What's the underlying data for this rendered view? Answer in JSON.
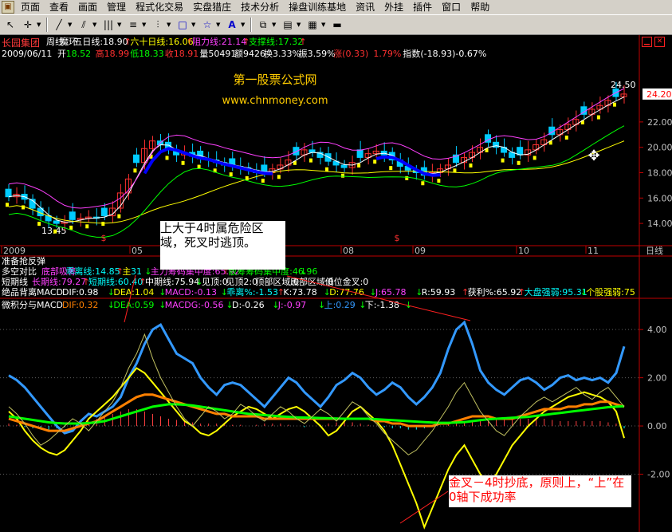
{
  "menu": [
    "页面",
    "查看",
    "画面",
    "管理",
    "程式化交易",
    "实盘猎庄",
    "技术分析",
    "操盘训练基地",
    "资讯",
    "外挂",
    "插件",
    "窗口",
    "帮助"
  ],
  "toolbar_icons": [
    "pointer",
    "cross",
    "line",
    "ray",
    "table",
    "chart",
    "pattern",
    "rect",
    "star",
    "text",
    "copy",
    "box",
    "palette",
    "save"
  ],
  "stock_name": "长园集团",
  "header1": [
    {
      "t": "周线",
      "c": "#ffffff"
    },
    {
      "t": "魔环",
      "c": "#ffffff"
    },
    {
      "t": "五日线:18.90",
      "c": "#ffffff"
    },
    {
      "t": "↑",
      "c": "#ff3030"
    },
    {
      "t": "六十日线:16.06",
      "c": "#ffff00"
    },
    {
      "t": "↑",
      "c": "#ff3030"
    },
    {
      "t": "阻力线:21.14",
      "c": "#ff40ff"
    },
    {
      "t": "↑",
      "c": "#ff3030"
    },
    {
      "t": "支撑线:17.32",
      "c": "#00ff00"
    },
    {
      "t": "↑",
      "c": "#ff3030"
    }
  ],
  "header2": [
    {
      "t": "2009/06/11",
      "c": "#ffffff"
    },
    {
      "t": "开",
      "c": "#ffffff"
    },
    {
      "t": "18.52",
      "c": "#00ff00"
    },
    {
      "t": "高18.99",
      "c": "#ff3030"
    },
    {
      "t": "低18.33",
      "c": "#00ff00"
    },
    {
      "t": "收18.91",
      "c": "#ff3030"
    },
    {
      "t": "量50491",
      "c": "#ffffff"
    },
    {
      "t": "额9426",
      "c": "#ffffff"
    },
    {
      "t": "换3.33%",
      "c": "#ffffff"
    },
    {
      "t": "振3.59%",
      "c": "#ffffff"
    },
    {
      "t": "涨(0.33)",
      "c": "#ff3030"
    },
    {
      "t": "1.79%",
      "c": "#ff3030"
    },
    {
      "t": "指数(-18.93)-0.67%",
      "c": "#ffffff"
    }
  ],
  "watermark": {
    "title": "第一股票公式网",
    "url": "www.chnmoney.com",
    "color": "#ffcc00"
  },
  "annotation_top": "上大于4时属危险区域，死叉时逃顶。",
  "annotation_bottom": "金叉－4时抄底，原则上，“上”在0轴下成功率",
  "last_price": "24.20",
  "peak_label": "24.50",
  "low_label": "13.45",
  "sell_marker": "$",
  "period_label": "日线",
  "month_labels": [
    "2009",
    "05",
    "06",
    "07",
    "08",
    "09",
    "10",
    "11"
  ],
  "row_names": [
    "准备抢反弹",
    "多空对比",
    "短期线",
    "绝品背离MACD",
    "微积分与MACD"
  ],
  "row_duokong": [
    {
      "t": "底部吸筹",
      "c": "#ff40ff"
    },
    {
      "t": "乖离线:14.85",
      "c": "#00ffff"
    },
    {
      "t": "↑",
      "c": "#ff3030"
    },
    {
      "t": "主",
      "c": "#ffff00"
    },
    {
      "t": "31",
      "c": "#00ffff"
    },
    {
      "t": "↓",
      "c": "#00ff00"
    },
    {
      "t": "主力筹码集中度:65.92",
      "c": "#ff40ff"
    },
    {
      "t": "↑",
      "c": "#ff3030"
    },
    {
      "t": "散筹筹码集中度:46.96",
      "c": "#00ff00"
    },
    {
      "t": "↓",
      "c": "#00ff00"
    }
  ],
  "row_duanqi": [
    {
      "t": "长期线:79.27",
      "c": "#ff40ff"
    },
    {
      "t": "↑",
      "c": "#ff3030"
    },
    {
      "t": "短期线:60.40",
      "c": "#00ffff"
    },
    {
      "t": "↑",
      "c": "#ff3030"
    },
    {
      "t": "中期线:75.94",
      "c": "#ffffff"
    },
    {
      "t": "↓",
      "c": "#00ff00"
    },
    {
      "t": "见顶:0",
      "c": "#ffffff"
    },
    {
      "t": "见顶2:0",
      "c": "#ffffff"
    },
    {
      "t": "顶部区域:0",
      "c": "#ffffff"
    },
    {
      "t": "底部区域:0",
      "c": "#ffffff"
    },
    {
      "t": "低位金叉:0",
      "c": "#ffffff"
    }
  ],
  "row_jueping": [
    {
      "t": "DIF:0.98",
      "c": "#ffffff"
    },
    {
      "t": "↓",
      "c": "#00ff00"
    },
    {
      "t": "DEA:1.04",
      "c": "#ffff00"
    },
    {
      "t": "↓",
      "c": "#00ff00"
    },
    {
      "t": "MACD:-0.13",
      "c": "#ff40ff"
    },
    {
      "t": "↓",
      "c": "#00ff00"
    },
    {
      "t": "乖离%:-1.53",
      "c": "#00ffff"
    },
    {
      "t": "↑",
      "c": "#ff3030"
    },
    {
      "t": "K:73.78",
      "c": "#ffffff"
    },
    {
      "t": "↓",
      "c": "#00ff00"
    },
    {
      "t": "D:77.76",
      "c": "#ffff00"
    },
    {
      "t": "↓",
      "c": "#00ff00"
    },
    {
      "t": "J:65.78",
      "c": "#ff40ff"
    },
    {
      "t": "↓",
      "c": "#00ff00"
    },
    {
      "t": "R:59.93",
      "c": "#ffffff"
    },
    {
      "t": "↑",
      "c": "#ff3030"
    },
    {
      "t": "获利%:65.92",
      "c": "#ffffff"
    },
    {
      "t": "↑",
      "c": "#ff3030"
    },
    {
      "t": "大盘强弱:95.31",
      "c": "#00ffff"
    },
    {
      "t": "↓",
      "c": "#00ff00"
    },
    {
      "t": "个股强弱:75",
      "c": "#ffff00"
    }
  ],
  "row_weiji": [
    {
      "t": "DIF:0.32",
      "c": "#ff8000"
    },
    {
      "t": "↓",
      "c": "#00ff00"
    },
    {
      "t": "DEA:0.59",
      "c": "#00ff00"
    },
    {
      "t": "↓",
      "c": "#00ff00"
    },
    {
      "t": "MACDG:-0.56",
      "c": "#ff40ff"
    },
    {
      "t": "↓",
      "c": "#00ff00"
    },
    {
      "t": "D:-0.26",
      "c": "#ffffff"
    },
    {
      "t": "↓",
      "c": "#00ff00"
    },
    {
      "t": "J:-0.97",
      "c": "#ff40ff"
    },
    {
      "t": "↓",
      "c": "#00ff00"
    },
    {
      "t": "上:0.29",
      "c": "#3399ff"
    },
    {
      "t": "↓",
      "c": "#00ff00"
    },
    {
      "t": "下:-1.38",
      "c": "#ffffff"
    },
    {
      "t": "↓",
      "c": "#00ff00"
    }
  ],
  "chart_data": [
    {
      "type": "candlestick",
      "price_axis": [
        14.0,
        16.0,
        18.0,
        20.0,
        22.0
      ],
      "ylim": [
        13.0,
        25.2
      ],
      "x_labels": [
        "2009",
        "05",
        "06",
        "07",
        "08",
        "09",
        "10",
        "11"
      ],
      "close_series": [
        16.1,
        16.3,
        15.9,
        15.2,
        14.6,
        14.2,
        14.0,
        14.1,
        14.3,
        14.4,
        14.5,
        14.4,
        14.6,
        15.2,
        16.4,
        17.5,
        18.8,
        19.9,
        20.5,
        20.2,
        19.8,
        19.4,
        19.6,
        19.3,
        19.1,
        19.0,
        18.8,
        18.6,
        18.5,
        18.4,
        18.2,
        18.0,
        18.0,
        18.3,
        18.6,
        19.0,
        19.4,
        19.8,
        19.6,
        19.2,
        18.9,
        18.6,
        18.4,
        18.8,
        19.2,
        19.5,
        19.7,
        19.4,
        19.0,
        18.5,
        18.2,
        18.0,
        17.8,
        18.0,
        18.3,
        18.6,
        18.8,
        19.2,
        19.6,
        20.0,
        20.4,
        20.0,
        19.6,
        19.2,
        19.4,
        19.8,
        20.2,
        20.6,
        21.0,
        21.4,
        21.8,
        22.2,
        22.6,
        23.0,
        23.3,
        23.7,
        24.0,
        24.2
      ],
      "ma_series": [
        {
          "name": "五日线",
          "color": "#ffffff"
        },
        {
          "name": "六十日线",
          "color": "#ffff00"
        },
        {
          "name": "阻力线",
          "color": "#ff40ff"
        },
        {
          "name": "支撑线",
          "color": "#00ff00"
        }
      ],
      "peak_value": 24.5,
      "low_value": 13.45,
      "last_value": 24.2
    },
    {
      "type": "line",
      "y_axis": [
        4.0,
        2.0,
        0.0,
        -2.0
      ],
      "ylim": [
        -4.3,
        4.8
      ],
      "series": [
        {
          "name": "上",
          "color": "#3399ff",
          "values": [
            2.1,
            1.9,
            1.6,
            1.2,
            0.8,
            0.4,
            0.0,
            -0.3,
            -0.2,
            0.2,
            0.5,
            0.4,
            0.6,
            0.8,
            1.2,
            2.0,
            2.6,
            3.4,
            4.0,
            4.2,
            3.6,
            3.0,
            2.8,
            2.6,
            2.0,
            1.6,
            1.3,
            1.7,
            1.8,
            1.7,
            1.4,
            1.1,
            0.8,
            1.2,
            1.6,
            2.0,
            1.8,
            1.4,
            1.1,
            0.8,
            1.2,
            1.7,
            1.9,
            2.2,
            2.0,
            1.6,
            1.3,
            1.5,
            1.8,
            1.6,
            1.2,
            0.9,
            1.2,
            1.6,
            2.2,
            3.2,
            4.0,
            4.3,
            3.4,
            2.3,
            1.8,
            1.5,
            1.3,
            1.6,
            1.9,
            2.0,
            1.8,
            1.5,
            1.7,
            2.0,
            2.1,
            1.9,
            2.0,
            1.9,
            2.0,
            1.8,
            2.2,
            3.3
          ]
        },
        {
          "name": "下",
          "color": "#ffff00",
          "values": [
            0.6,
            0.3,
            -0.2,
            -0.6,
            -0.9,
            -1.1,
            -1.2,
            -1.0,
            -0.6,
            -0.2,
            0.3,
            0.6,
            0.9,
            1.2,
            1.6,
            2.0,
            2.4,
            2.2,
            1.8,
            1.4,
            1.0,
            0.6,
            0.2,
            0.0,
            -0.3,
            -0.4,
            -0.2,
            0.1,
            0.4,
            0.6,
            0.8,
            0.7,
            0.5,
            0.3,
            0.5,
            0.7,
            0.8,
            0.6,
            0.3,
            0.0,
            -0.4,
            -0.2,
            0.2,
            0.6,
            0.8,
            0.5,
            0.2,
            -0.2,
            -0.8,
            -1.6,
            -2.4,
            -3.2,
            -4.2,
            -3.4,
            -2.6,
            -1.8,
            -1.2,
            -0.8,
            -1.4,
            -2.0,
            -2.4,
            -2.0,
            -1.4,
            -0.8,
            -0.4,
            0.0,
            0.3,
            0.6,
            0.8,
            1.0,
            1.2,
            1.3,
            1.4,
            1.3,
            1.2,
            1.0,
            0.6,
            -0.5
          ]
        },
        {
          "name": "DIF",
          "color": "#ff8000",
          "values": [
            0.3,
            0.2,
            0.1,
            0.0,
            -0.1,
            -0.2,
            -0.2,
            -0.2,
            -0.1,
            0.0,
            0.1,
            0.2,
            0.4,
            0.6,
            0.8,
            1.0,
            1.2,
            1.3,
            1.3,
            1.2,
            1.1,
            1.0,
            0.9,
            0.8,
            0.7,
            0.6,
            0.5,
            0.5,
            0.4,
            0.4,
            0.4,
            0.4,
            0.3,
            0.3,
            0.3,
            0.3,
            0.3,
            0.3,
            0.3,
            0.3,
            0.3,
            0.3,
            0.3,
            0.3,
            0.3,
            0.3,
            0.2,
            0.2,
            0.1,
            0.1,
            0.0,
            0.0,
            0.0,
            0.0,
            0.1,
            0.1,
            0.2,
            0.3,
            0.4,
            0.4,
            0.4,
            0.3,
            0.3,
            0.3,
            0.4,
            0.5,
            0.6,
            0.7,
            0.7,
            0.7,
            0.8,
            0.8,
            0.9,
            0.9,
            1.0,
            1.0,
            0.9,
            0.8
          ]
        },
        {
          "name": "DEA",
          "color": "#00ff00",
          "values": [
            0.4,
            0.35,
            0.3,
            0.25,
            0.2,
            0.15,
            0.12,
            0.1,
            0.1,
            0.1,
            0.12,
            0.15,
            0.2,
            0.3,
            0.4,
            0.5,
            0.6,
            0.7,
            0.8,
            0.85,
            0.9,
            0.9,
            0.88,
            0.85,
            0.8,
            0.75,
            0.7,
            0.65,
            0.6,
            0.55,
            0.5,
            0.48,
            0.45,
            0.43,
            0.4,
            0.38,
            0.36,
            0.35,
            0.34,
            0.33,
            0.32,
            0.31,
            0.3,
            0.3,
            0.3,
            0.3,
            0.28,
            0.26,
            0.24,
            0.22,
            0.2,
            0.18,
            0.16,
            0.14,
            0.13,
            0.13,
            0.14,
            0.16,
            0.2,
            0.24,
            0.28,
            0.3,
            0.32,
            0.34,
            0.36,
            0.38,
            0.42,
            0.46,
            0.5,
            0.54,
            0.58,
            0.62,
            0.66,
            0.7,
            0.74,
            0.78,
            0.8,
            0.82
          ]
        },
        {
          "name": "D",
          "color": "#c0c060",
          "values": [
            0.8,
            0.5,
            0.1,
            -0.4,
            -0.8,
            -0.6,
            -0.3,
            0.0,
            0.3,
            0.1,
            -0.2,
            0.2,
            0.6,
            1.0,
            1.6,
            2.4,
            3.0,
            3.8,
            2.8,
            2.0,
            1.4,
            0.8,
            0.3,
            0.0,
            0.4,
            0.8,
            0.6,
            0.3,
            0.5,
            0.9,
            0.7,
            0.4,
            0.2,
            0.5,
            0.8,
            0.6,
            0.3,
            0.1,
            0.4,
            0.7,
            0.5,
            0.2,
            0.6,
            1.0,
            0.8,
            0.4,
            0.1,
            -0.3,
            -0.6,
            -0.9,
            -1.2,
            -1.0,
            -0.6,
            -0.2,
            0.3,
            0.8,
            1.4,
            1.8,
            1.2,
            0.6,
            0.2,
            -0.2,
            -0.4,
            0.0,
            0.4,
            0.7,
            1.0,
            1.2,
            1.0,
            1.2,
            1.4,
            1.6,
            1.3,
            1.1,
            1.4,
            1.6,
            1.2,
            0.8
          ]
        }
      ],
      "bars": {
        "name": "MACDG",
        "color_pos": "#ff4040",
        "color_neg": "#00ffff",
        "values": [
          0.1,
          0.05,
          -0.05,
          -0.1,
          -0.15,
          -0.15,
          -0.1,
          -0.05,
          0.0,
          0.1,
          0.2,
          0.3,
          0.4,
          0.5,
          0.6,
          0.7,
          0.7,
          0.6,
          0.5,
          0.4,
          0.3,
          0.25,
          0.2,
          0.15,
          0.1,
          0.1,
          0.1,
          0.1,
          0.05,
          0.05,
          0.0,
          0.05,
          0.1,
          0.1,
          0.1,
          0.05,
          0.0,
          -0.05,
          0.0,
          0.05,
          0.1,
          0.15,
          0.2,
          0.15,
          0.1,
          0.05,
          0.0,
          -0.05,
          -0.1,
          -0.1,
          -0.15,
          -0.15,
          -0.1,
          -0.05,
          0.0,
          0.05,
          0.1,
          0.15,
          0.2,
          0.2,
          0.25,
          0.3,
          0.3,
          0.3,
          0.3,
          0.3,
          0.3,
          0.3,
          0.25,
          0.2,
          0.2,
          0.2,
          0.2,
          0.2,
          0.2,
          0.15,
          0.1,
          -0.1
        ]
      }
    }
  ]
}
